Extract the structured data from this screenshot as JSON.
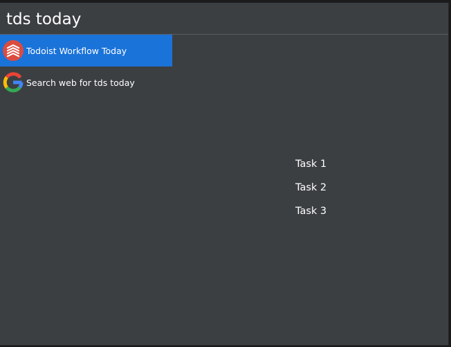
{
  "search": {
    "value": "tds today"
  },
  "results": [
    {
      "label": "Todoist Workflow Today",
      "icon": "todoist-icon",
      "selected": true
    },
    {
      "label": "Search web for tds today",
      "icon": "google-icon",
      "selected": false
    }
  ],
  "preview": {
    "tasks": [
      {
        "label": "Task 1"
      },
      {
        "label": "Task 2"
      },
      {
        "label": "Task 3"
      }
    ]
  },
  "colors": {
    "background": "#3c3f42",
    "selected": "#1a73d9",
    "todoist": "#db4c3f"
  }
}
